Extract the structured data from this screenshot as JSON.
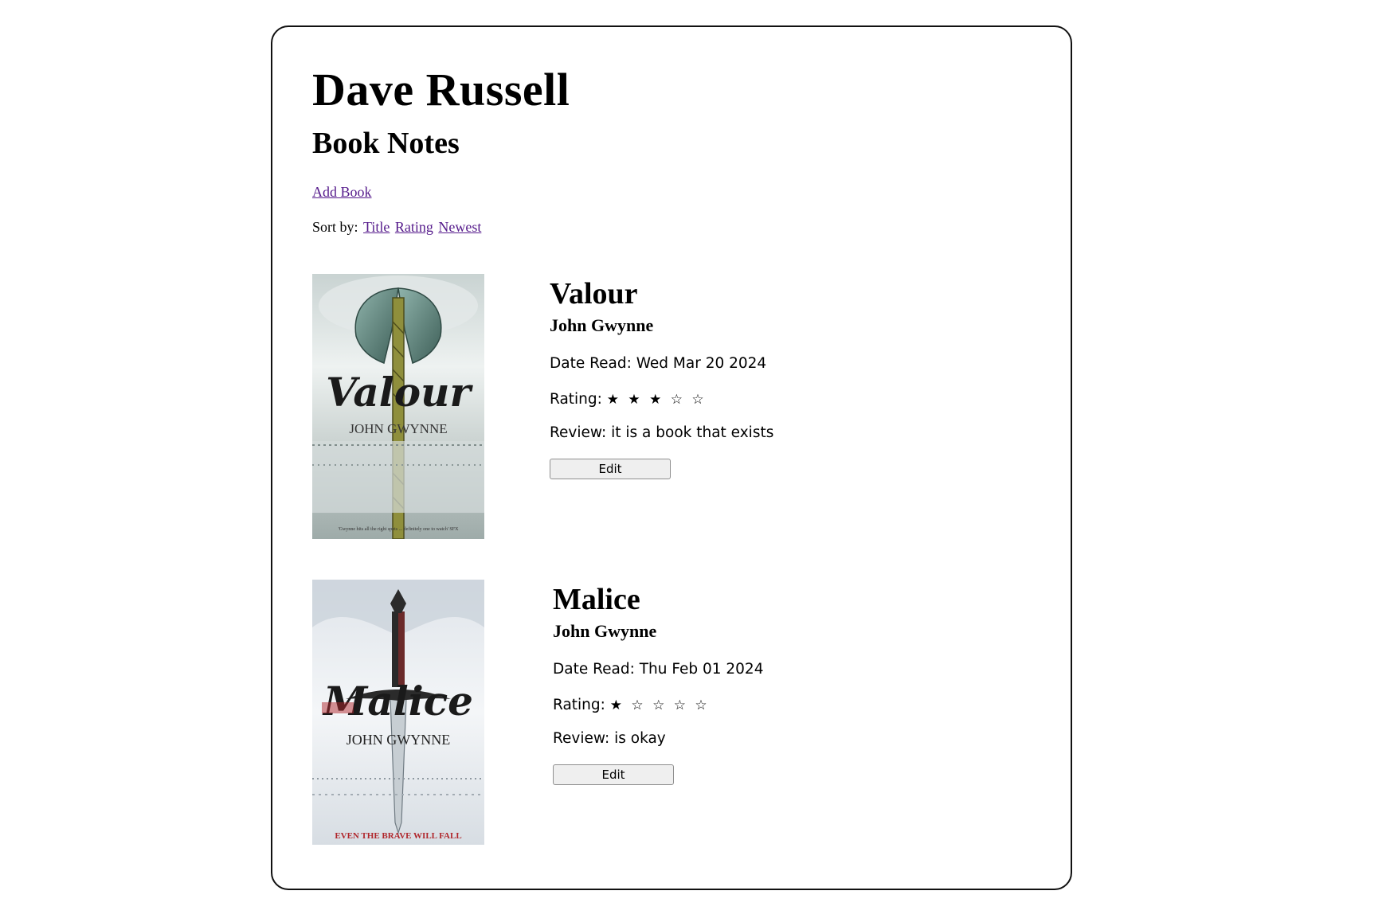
{
  "header": {
    "title": "Dave Russell",
    "subtitle": "Book Notes"
  },
  "nav": {
    "add_book": "Add Book",
    "sort_label": "Sort by:",
    "sort_options": [
      "Title",
      "Rating",
      "Newest"
    ]
  },
  "books": [
    {
      "title": "Valour",
      "author": "John Gwynne",
      "date_read": "Date Read: Wed Mar 20 2024",
      "rating_label": "Rating:",
      "rating_value": 3,
      "rating_max": 5,
      "stars": "★ ★ ★ ☆ ☆",
      "review": "Review: it is a book that exists",
      "edit_label": "Edit",
      "cover": {
        "title_text": "Valour",
        "author_text": "JOHN GWYNNE",
        "blurb_text": "'Gwynne hits all the right spots ... definitely one to watch' SFX",
        "accent": "#5f8c84"
      }
    },
    {
      "title": "Malice",
      "author": "John Gwynne",
      "date_read": "Date Read: Thu Feb 01 2024",
      "rating_label": "Rating:",
      "rating_value": 1,
      "rating_max": 5,
      "stars": "★ ☆ ☆ ☆ ☆",
      "review": "Review: is okay",
      "edit_label": "Edit",
      "cover": {
        "title_text": "Malice",
        "author_text": "JOHN GWYNNE",
        "tagline_text": "EVEN THE BRAVE WILL FALL",
        "accent": "#b0262b"
      }
    }
  ]
}
